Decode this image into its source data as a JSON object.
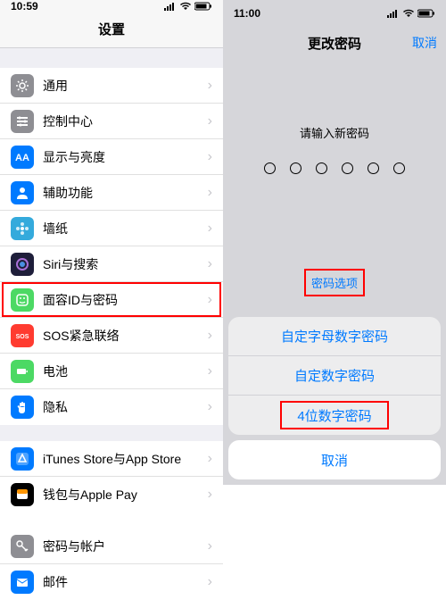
{
  "left": {
    "time": "10:59",
    "title": "设置",
    "groups": [
      [
        {
          "label": "通用",
          "color": "#8e8e93",
          "icon": "gear"
        },
        {
          "label": "控制中心",
          "color": "#8e8e93",
          "icon": "sliders"
        },
        {
          "label": "显示与亮度",
          "color": "#007aff",
          "icon": "aa"
        },
        {
          "label": "辅助功能",
          "color": "#007aff",
          "icon": "person"
        },
        {
          "label": "墙纸",
          "color": "#34aadc",
          "icon": "flower"
        },
        {
          "label": "Siri与搜索",
          "color": "#1e1e3a",
          "icon": "siri"
        },
        {
          "label": "面容ID与密码",
          "color": "#4cd964",
          "icon": "face",
          "hl": true
        },
        {
          "label": "SOS紧急联络",
          "color": "#ff3b30",
          "icon": "sos"
        },
        {
          "label": "电池",
          "color": "#4cd964",
          "icon": "battery"
        },
        {
          "label": "隐私",
          "color": "#007aff",
          "icon": "hand"
        }
      ],
      [
        {
          "label": "iTunes Store与App Store",
          "color": "#007aff",
          "icon": "appstore"
        },
        {
          "label": "钱包与Apple Pay",
          "color": "#000000",
          "icon": "wallet"
        }
      ],
      [
        {
          "label": "密码与帐户",
          "color": "#8e8e93",
          "icon": "key"
        },
        {
          "label": "邮件",
          "color": "#007aff",
          "icon": "mail"
        }
      ]
    ]
  },
  "right": {
    "time": "11:00",
    "title": "更改密码",
    "cancel": "取消",
    "prompt": "请输入新密码",
    "options_link": "密码选项",
    "sheet": [
      "自定字母数字密码",
      "自定数字密码",
      "4位数字密码"
    ],
    "sheet_cancel": "取消"
  }
}
